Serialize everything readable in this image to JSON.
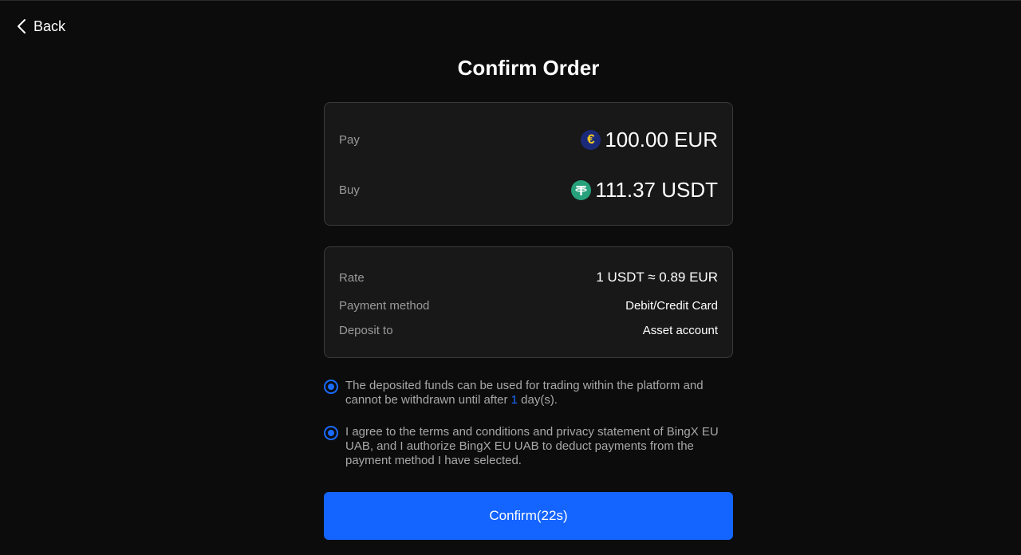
{
  "nav": {
    "back_label": "Back"
  },
  "page": {
    "title": "Confirm Order"
  },
  "order": {
    "pay_label": "Pay",
    "pay_amount": "100.00 EUR",
    "pay_currency_icon": "euro-coin-icon",
    "buy_label": "Buy",
    "buy_amount": "111.37 USDT",
    "buy_currency_icon": "tether-coin-icon"
  },
  "details": {
    "rate_label": "Rate",
    "rate_value": "1 USDT ≈ 0.89 EUR",
    "payment_method_label": "Payment method",
    "payment_method_value": "Debit/Credit Card",
    "deposit_to_label": "Deposit to",
    "deposit_to_value": "Asset account"
  },
  "agreements": {
    "withdrawal_notice_pre": "The deposited funds can be used for trading within the platform and cannot be withdrawn until after ",
    "withdrawal_days": "1",
    "withdrawal_notice_post": " day(s).",
    "terms_text": "I agree to the terms and conditions and privacy statement of BingX EU UAB, and I authorize BingX EU UAB to deduct payments from the payment method I have selected.",
    "withdrawal_checked": true,
    "terms_checked": true
  },
  "actions": {
    "confirm_label": "Confirm(22s)"
  },
  "colors": {
    "background": "#0c0c0c",
    "card": "#181818",
    "accent": "#1464ff",
    "label": "#9a9a9a"
  }
}
